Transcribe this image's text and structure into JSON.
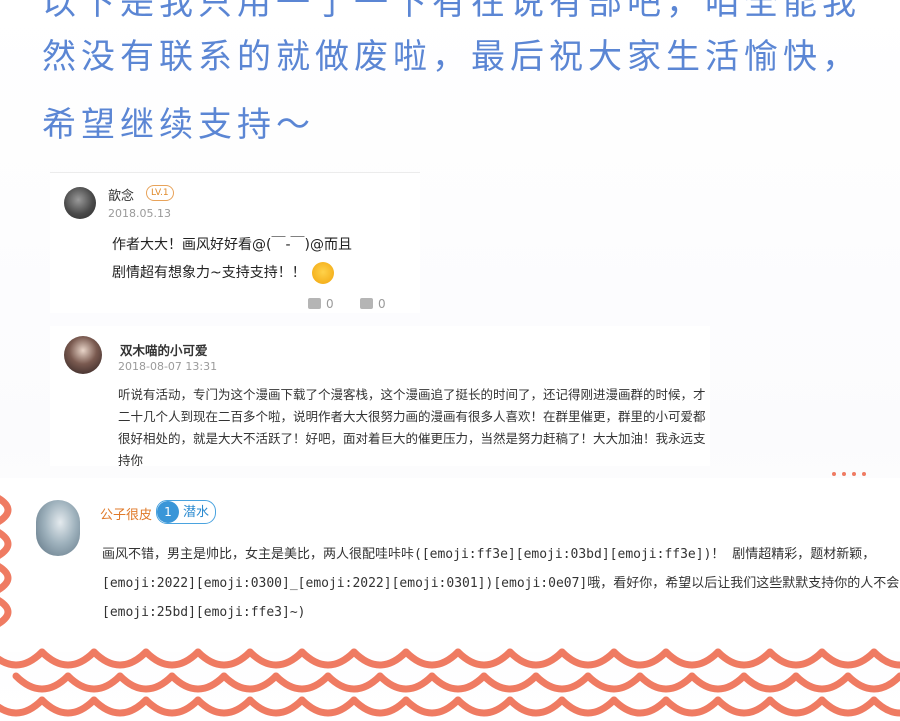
{
  "header_text": {
    "line0": "以下是我只用一了一下有在说有部吧，咱全能我",
    "line1": "然没有联系的就做废啦，最后祝大家生活愉快，",
    "line2": "希望继续支持～"
  },
  "comments": [
    {
      "username": "歆念",
      "level": "LV.1",
      "date": "2018.05.13",
      "line1": "作者大大！画风好好看@(￣-￣)@而且",
      "line2": "剧情超有想象力~支持支持！！",
      "likes": "0",
      "replies": "0"
    },
    {
      "username": "双木喵的小可爱",
      "date": "2018-08-07 13:31",
      "text": "听说有活动，专门为这个漫画下载了个漫客栈，这个漫画追了挺长的时间了，还记得刚进漫画群的时候，才二十几个人到现在二百多个啦，说明作者大大很努力画的漫画有很多人喜欢！在群里催更，群里的小可爱都很好相处的，就是大大不活跃了！好吧，面对着巨大的催更压力，当然是努力赶稿了！大大加油！我永远支持你"
    },
    {
      "username": "公子很皮",
      "badge_num": "1",
      "badge_label": "潜水",
      "line1": "画风不错，男主是帅比，女主是美比，两人很配哇咔咔([emoji:ff3e][emoji:03bd][emoji:ff3e])！ 剧情超精彩，题材新颖，",
      "line2": "[emoji:2022][emoji:0300]_[emoji:2022][emoji:0301])[emoji:0e07]哦，看好你，希望以后让我们这些默默支持你的人不会",
      "line3": "[emoji:25bd][emoji:ffe3]~)"
    }
  ],
  "colors": {
    "header_blue": "#5b86d4",
    "scallop_orange": "#ef7b62",
    "username_orange": "#e07a2a",
    "badge_blue": "#3a96d8"
  }
}
